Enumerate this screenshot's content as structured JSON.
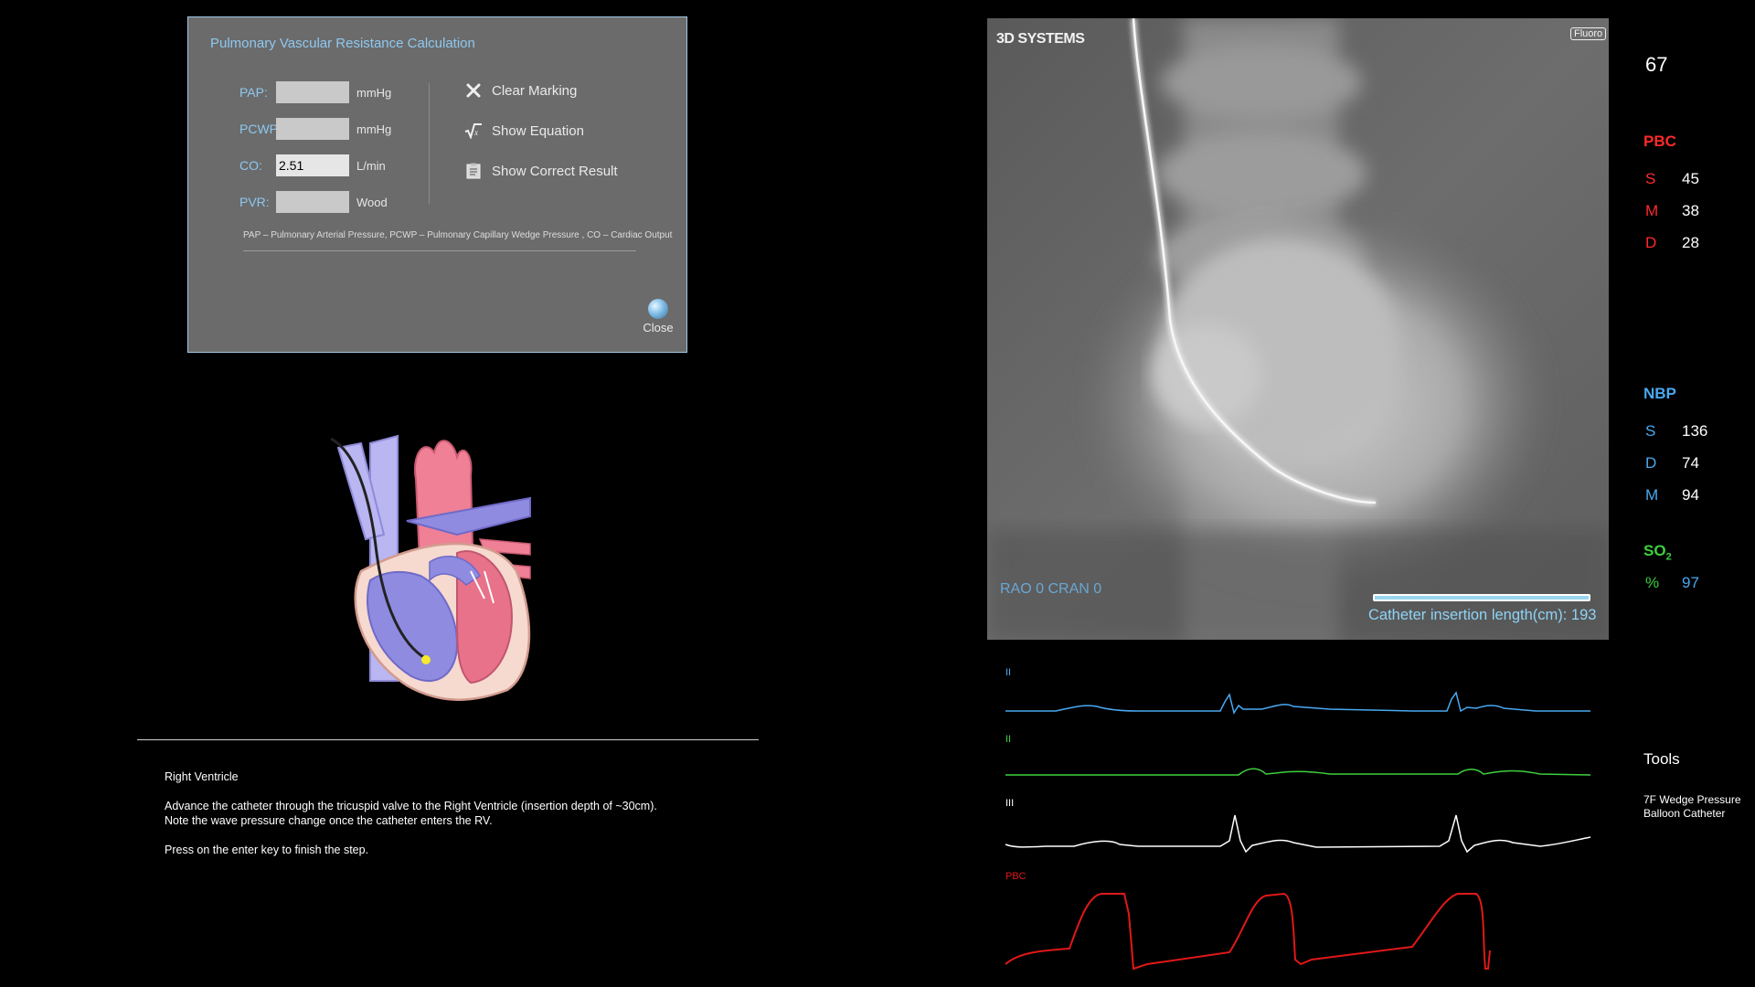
{
  "pvr_dialog": {
    "title": "Pulmonary Vascular Resistance Calculation",
    "fields": [
      {
        "label": "PAP:",
        "value": "",
        "unit": "mmHg"
      },
      {
        "label": "PCWP:",
        "value": "",
        "unit": "mmHg"
      },
      {
        "label": "CO:",
        "value": "2.51",
        "unit": "L/min"
      },
      {
        "label": "PVR:",
        "value": "",
        "unit": "Wood"
      }
    ],
    "actions": [
      {
        "label": "Clear Marking",
        "icon": "x-icon"
      },
      {
        "label": "Show Equation",
        "icon": "sqrt-icon"
      },
      {
        "label": "Show Correct Result",
        "icon": "clipboard-icon"
      }
    ],
    "legend": "PAP – Pulmonary Arterial Pressure, PCWP – Pulmonary Capillary Wedge Pressure , CO – Cardiac Output",
    "close_label": "Close"
  },
  "instructions": {
    "heading": "Right Ventricle",
    "line1": "Advance the catheter through the tricuspid valve to the Right Ventricle (insertion depth of ~30cm).",
    "line2": "Note the wave pressure change once the catheter enters the RV.",
    "line3": "Press on the enter key to finish the step."
  },
  "fluoro": {
    "logo": "3D SYSTEMS",
    "badge": "Fluoro",
    "angles": "RAO   0 CRAN   0",
    "catheter_text": "Catheter insertion length(cm): 193"
  },
  "vitals": {
    "heart_rate": "67",
    "pbc": {
      "title": "PBC",
      "s_label": "S",
      "s": "45",
      "m_label": "M",
      "m": "38",
      "d_label": "D",
      "d": "28"
    },
    "nbp": {
      "title": "NBP",
      "s_label": "S",
      "s": "136",
      "d_label": "D",
      "d": "74",
      "m_label": "M",
      "m": "94"
    },
    "so2": {
      "title": "SO",
      "sub": "2",
      "pct_label": "%",
      "value": "97"
    }
  },
  "tools": {
    "title": "Tools",
    "item": "7F Wedge Pressure Balloon Catheter"
  },
  "waveforms": {
    "labels": [
      "II",
      "II",
      "III",
      "PBC"
    ],
    "colors": [
      "#4aa8f0",
      "#3ed03e",
      "#ffffff",
      "#e01818"
    ]
  },
  "colors": {
    "pbc": "#ff2a2a",
    "nbp": "#4aa8f0",
    "so2": "#3ed03e",
    "dialog_accent": "#8ec8f0"
  }
}
